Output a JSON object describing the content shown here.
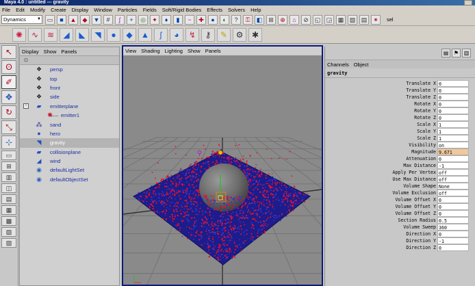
{
  "window": {
    "title": "Maya 4.0 : untitled  ---  gravity",
    "minimize_glyph": "_"
  },
  "menubar": [
    "File",
    "Edit",
    "Modify",
    "Create",
    "Display",
    "Window",
    "Particles",
    "Fields",
    "Soft/Rigid Bodies",
    "Effects",
    "Solvers",
    "Help"
  ],
  "statusline": {
    "mode": "Dynamics",
    "sel_label": "sel"
  },
  "status_icons": [
    "folder-icon",
    "save-icon",
    "select-hierarchy-icon",
    "select-object-icon",
    "select-component-icon",
    "snap-grid-icon",
    "snap-curve-icon",
    "snap-point-icon",
    "history-icon",
    "render-icon",
    "ipr-icon"
  ],
  "shelf_icons": [
    "emitter-icon",
    "particle-tool-icon",
    "curve-flow-icon",
    "air-field-icon",
    "drag-field-icon",
    "gravity-field-icon",
    "newton-field-icon",
    "radial-field-icon",
    "turbulence-field-icon",
    "uniform-field-icon",
    "vortex-field-icon",
    "volume-axis-icon",
    "connect-field-icon",
    "goal-icon",
    "collision-icon",
    "instancer-icon"
  ],
  "viewport_menu": [
    "View",
    "Shading",
    "Lighting",
    "Show",
    "Panels"
  ],
  "outliner_menu": [
    "Display",
    "Show",
    "Panels"
  ],
  "outliner": [
    {
      "label": "persp",
      "icon": "camera-icon"
    },
    {
      "label": "top",
      "icon": "camera-icon"
    },
    {
      "label": "front",
      "icon": "camera-icon"
    },
    {
      "label": "side",
      "icon": "camera-icon"
    },
    {
      "label": "emitterplane",
      "icon": "nurbs-plane-icon",
      "expand": "-"
    },
    {
      "label": "emitter1",
      "icon": "emitter-icon",
      "child": true
    },
    {
      "label": "sand",
      "icon": "particle-icon"
    },
    {
      "label": "hero",
      "icon": "sphere-icon"
    },
    {
      "label": "gravity",
      "icon": "gravity-icon",
      "selected": true
    },
    {
      "label": "collisionplane",
      "icon": "nurbs-plane-icon"
    },
    {
      "label": "wind",
      "icon": "air-field-icon"
    },
    {
      "label": "defaultLightSet",
      "icon": "set-icon"
    },
    {
      "label": "defaultObjectSet",
      "icon": "set-icon"
    }
  ],
  "channelbox": {
    "menu": [
      "Channels",
      "Object"
    ],
    "object": "gravity",
    "attributes": [
      {
        "name": "Translate X",
        "value": "0"
      },
      {
        "name": "Translate Y",
        "value": "0"
      },
      {
        "name": "Translate Z",
        "value": "0"
      },
      {
        "name": "Rotate X",
        "value": "0"
      },
      {
        "name": "Rotate Y",
        "value": "0"
      },
      {
        "name": "Rotate Z",
        "value": "0"
      },
      {
        "name": "Scale X",
        "value": "1"
      },
      {
        "name": "Scale Y",
        "value": "1"
      },
      {
        "name": "Scale Z",
        "value": "1"
      },
      {
        "name": "Visibility",
        "value": "on"
      },
      {
        "name": "Magnitude",
        "value": "9.671",
        "highlight": true
      },
      {
        "name": "Attenuation",
        "value": "0"
      },
      {
        "name": "Max Distance",
        "value": "-1"
      },
      {
        "name": "Apply Per Vertex",
        "value": "off"
      },
      {
        "name": "Use Max Distance",
        "value": "off"
      },
      {
        "name": "Volume Shape",
        "value": "None"
      },
      {
        "name": "Volume Exclusion",
        "value": "off"
      },
      {
        "name": "Volume Offset X",
        "value": "0"
      },
      {
        "name": "Volume Offset Y",
        "value": "0"
      },
      {
        "name": "Volume Offset Z",
        "value": "0"
      },
      {
        "name": "Section Radius",
        "value": "0.5"
      },
      {
        "name": "Volume Sweep",
        "value": "360"
      },
      {
        "name": "Direction X",
        "value": "0"
      },
      {
        "name": "Direction Y",
        "value": "-1"
      },
      {
        "name": "Direction Z",
        "value": "0"
      }
    ]
  },
  "colors": {
    "particle_red": "#e8102a",
    "particle_blue": "#1c1ca0",
    "selection_blue": "#0a1a7a",
    "highlight": "#f2c79a"
  }
}
